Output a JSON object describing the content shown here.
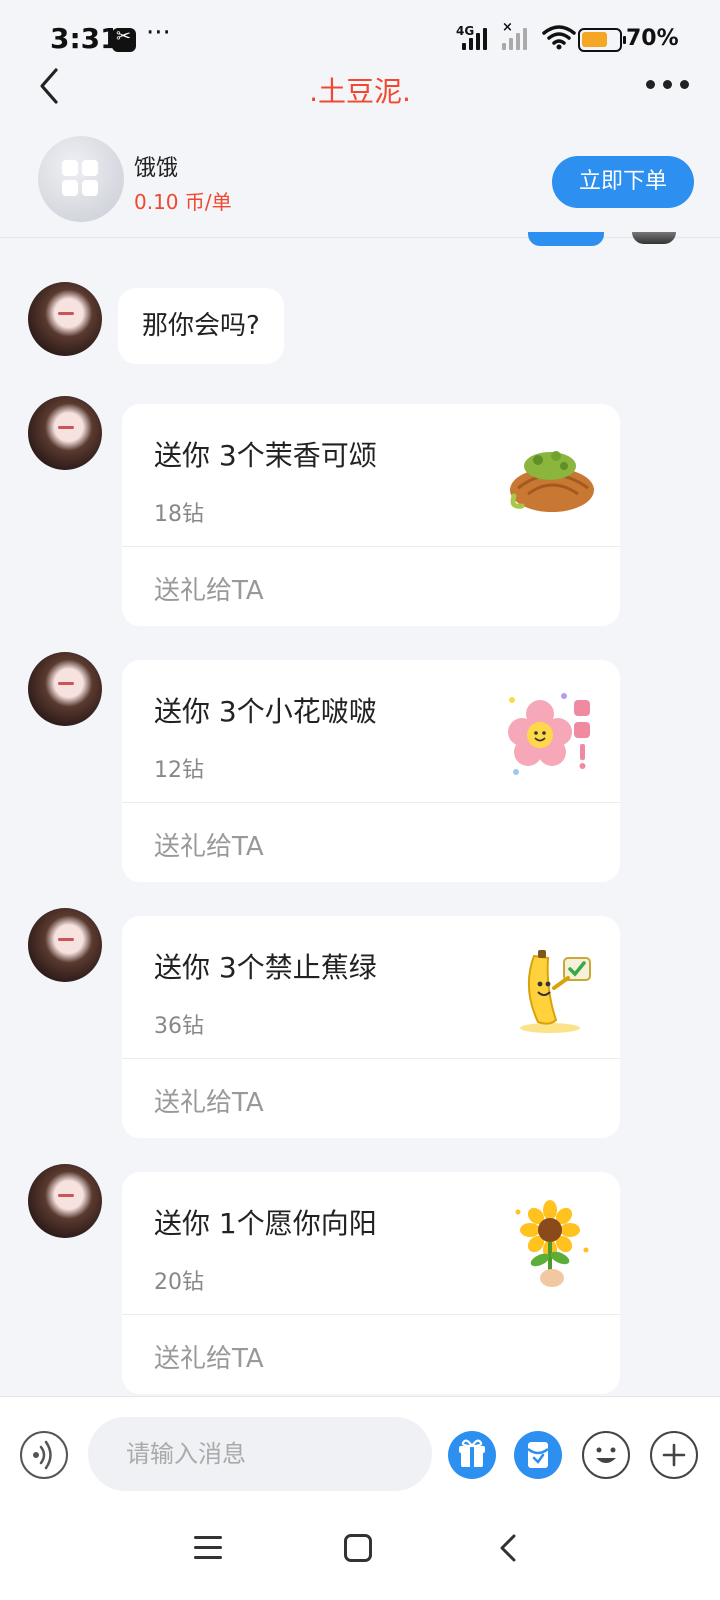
{
  "status_bar": {
    "time": "3:31",
    "network": "4G",
    "battery_percent_text": "70%",
    "battery_level": 0.7,
    "battery_color": "#f5a623"
  },
  "header": {
    "title": ".土豆泥.",
    "title_color": "#f2482f",
    "back_icon": "chevron-left-icon",
    "more_icon": "more-dots-icon"
  },
  "service": {
    "name": "饿饿",
    "price": "0.10 币/单",
    "order_button": "立即下单",
    "accent": "#2d8ff0"
  },
  "messages": {
    "text": "那你会吗?",
    "gifts": [
      {
        "title": "送你 3个茉香可颂",
        "price": "18钻",
        "action": "送礼给TA",
        "icon": "croissant-icon"
      },
      {
        "title": "送你 3个小花啵啵",
        "price": "12钻",
        "action": "送礼给TA",
        "icon": "flower-icon"
      },
      {
        "title": "送你 3个禁止蕉绿",
        "price": "36钻",
        "action": "送礼给TA",
        "icon": "banana-icon"
      },
      {
        "title": "送你 1个愿你向阳",
        "price": "20钻",
        "action": "送礼给TA",
        "icon": "sunflower-icon"
      }
    ]
  },
  "input": {
    "placeholder": "请输入消息"
  }
}
